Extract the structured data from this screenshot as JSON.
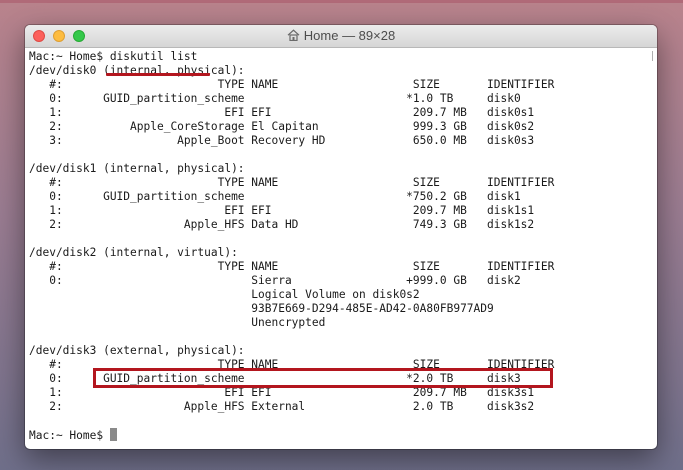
{
  "window": {
    "title": "Home — 89×28"
  },
  "terminal": {
    "lines": [
      "Mac:~ Home$ diskutil list",
      "/dev/disk0 (internal, physical):",
      "   #:                       TYPE NAME                    SIZE       IDENTIFIER",
      "   0:      GUID_partition_scheme                        *1.0 TB     disk0",
      "   1:                        EFI EFI                     209.7 MB   disk0s1",
      "   2:          Apple_CoreStorage El Capitan              999.3 GB   disk0s2",
      "   3:                 Apple_Boot Recovery HD             650.0 MB   disk0s3",
      "",
      "/dev/disk1 (internal, physical):",
      "   #:                       TYPE NAME                    SIZE       IDENTIFIER",
      "   0:      GUID_partition_scheme                        *750.2 GB   disk1",
      "   1:                        EFI EFI                     209.7 MB   disk1s1",
      "   2:                  Apple_HFS Data HD                 749.3 GB   disk1s2",
      "",
      "/dev/disk2 (internal, virtual):",
      "   #:                       TYPE NAME                    SIZE       IDENTIFIER",
      "   0:                            Sierra                 +999.0 GB   disk2",
      "                                 Logical Volume on disk0s2",
      "                                 93B7E669-D294-485E-AD42-0A80FB977AD9",
      "                                 Unencrypted",
      "",
      "/dev/disk3 (external, physical):",
      "   #:                       TYPE NAME                    SIZE       IDENTIFIER",
      "   0:      GUID_partition_scheme                        *2.0 TB     disk3",
      "   1:                        EFI EFI                     209.7 MB   disk3s1",
      "   2:                  Apple_HFS External                2.0 TB     disk3s2",
      "",
      "Mac:~ Home$ "
    ]
  },
  "colors": {
    "highlight": "#b3161e",
    "text": "#1a1a1a",
    "cursor": "#8a8a8a"
  },
  "icons": {
    "title": "house-icon"
  }
}
